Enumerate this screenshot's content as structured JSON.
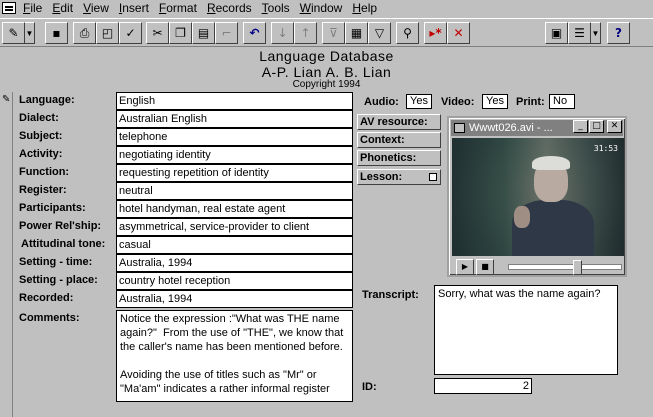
{
  "menu": [
    "File",
    "Edit",
    "View",
    "Insert",
    "Format",
    "Records",
    "Tools",
    "Window",
    "Help"
  ],
  "toolbar": {
    "icons": [
      "design-view-icon",
      "save-icon",
      "print-icon",
      "print-preview-icon",
      "spelling-icon",
      "cut-icon",
      "copy-icon",
      "paste-icon",
      "format-painter-icon",
      "undo-icon",
      "sort-ascending-icon",
      "sort-descending-icon",
      "filter-by-selection-icon",
      "filter-by-form-icon",
      "apply-filter-icon",
      "find-icon",
      "new-record-icon",
      "delete-record-icon",
      "database-window-icon",
      "new-object-icon",
      "help-icon"
    ]
  },
  "header": {
    "title": "Language Database",
    "authors": "A-P. Lian  A. B. Lian",
    "copyright": "Copyright 1994"
  },
  "record": {
    "language_label": "Language:",
    "language": "English",
    "dialect_label": "Dialect:",
    "dialect": "Australian English",
    "subject_label": "Subject:",
    "subject": "telephone",
    "activity_label": "Activity:",
    "activity": "negotiating identity",
    "function_label": "Function:",
    "function": "requesting repetition of identity",
    "register_label": "Register:",
    "register": "neutral",
    "participants_label": "Participants:",
    "participants": "hotel handyman, real estate agent",
    "power_label": "Power Rel'ship:",
    "power": "asymmetrical, service-provider to client",
    "attitudinal_label": "Attitudinal tone:",
    "attitudinal": "casual",
    "setting_time_label": "Setting - time:",
    "setting_time": "Australia, 1994",
    "setting_place_label": "Setting - place:",
    "setting_place": "country hotel reception",
    "recorded_label": "Recorded:",
    "recorded": "Australia, 1994",
    "comments_label": "Comments:",
    "comments": "Notice the expression :\"What was THE name again?\"  From the use of \"THE\", we know that the caller's name has been mentioned before.\n\nAvoiding the use of titles such as \"Mr\" or \"Ma'am\" indicates a rather informal register",
    "audio_label": "Audio:",
    "audio": "Yes",
    "video_label": "Video:",
    "video": "Yes",
    "print_label": "Print:",
    "print": "No",
    "av_resource_label": "AV resource:",
    "context_label": "Context:",
    "phonetics_label": "Phonetics:",
    "lesson_label": "Lesson:",
    "transcript_label": "Transcript:",
    "transcript": "Sorry, what was the name again?",
    "id_label": "ID:",
    "id": "2"
  },
  "video_window": {
    "title": "Wwwt026.avi - ...",
    "timestamp": "31:53",
    "position": 0.62
  }
}
